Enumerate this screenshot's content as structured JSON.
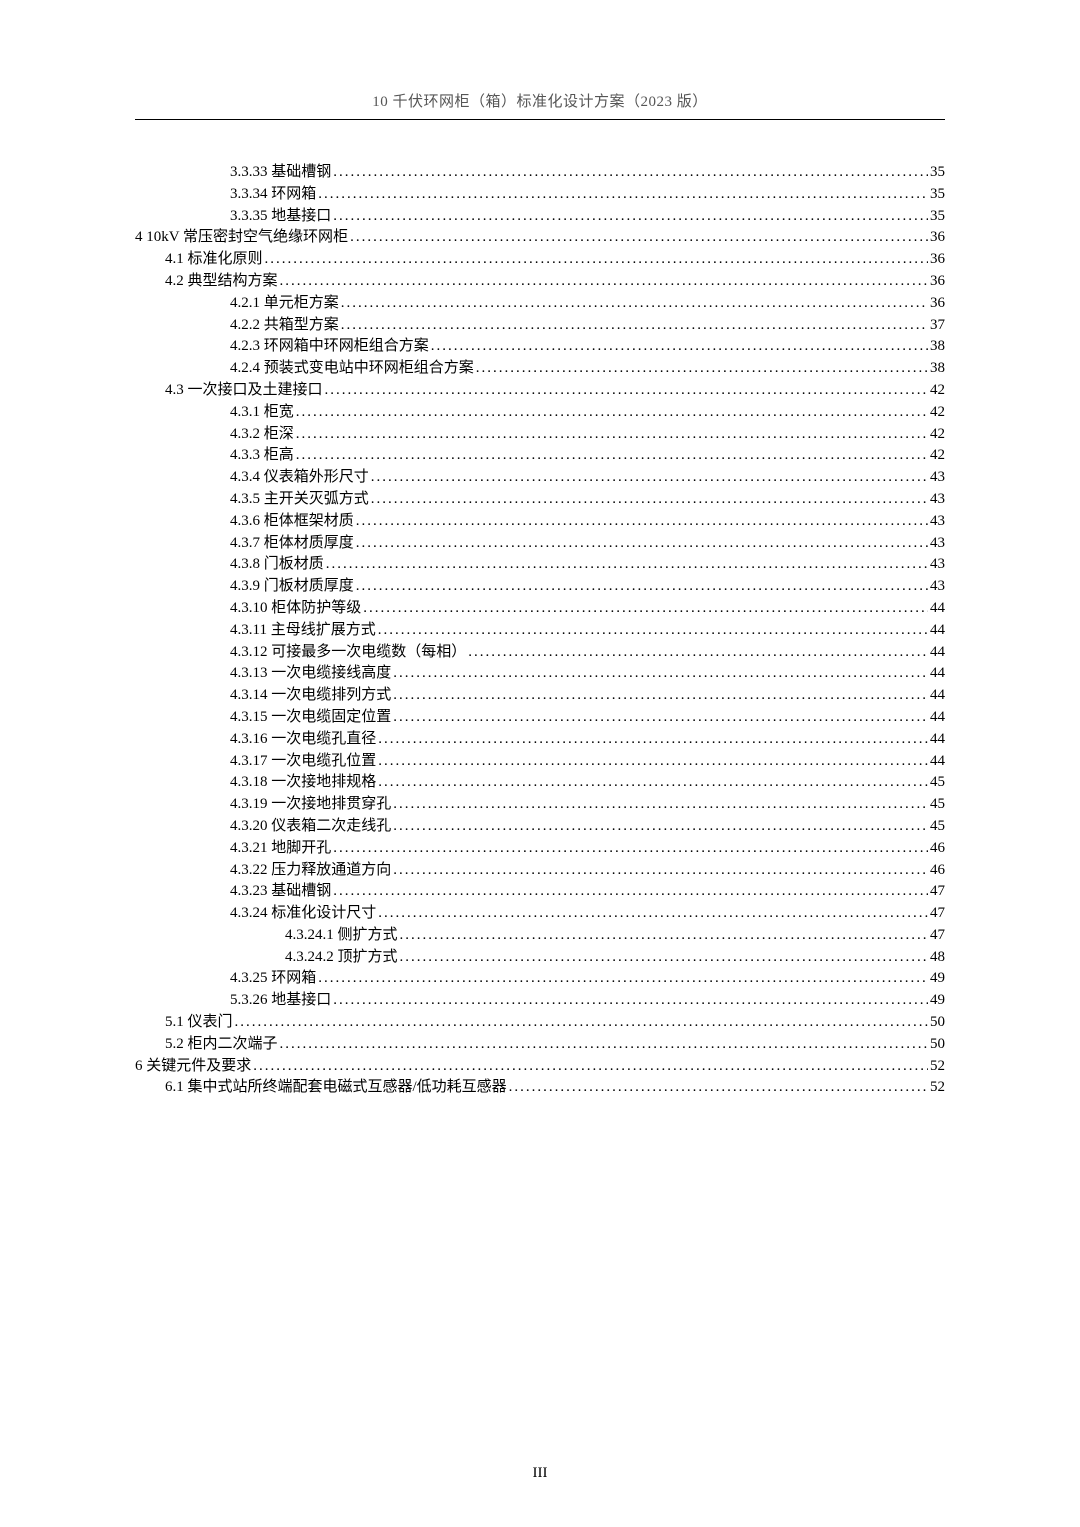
{
  "header": "10 千伏环网柜（箱）标准化设计方案（2023 版）",
  "footer": "III",
  "toc": [
    {
      "indent": 3,
      "label": "3.3.33 基础槽钢",
      "page": "35"
    },
    {
      "indent": 3,
      "label": "3.3.34 环网箱",
      "page": "35"
    },
    {
      "indent": 3,
      "label": "3.3.35 地基接口",
      "page": "35"
    },
    {
      "indent": 0,
      "label": "4 10kV 常压密封空气绝缘环网柜",
      "page": "36"
    },
    {
      "indent": 1,
      "label": "4.1 标准化原则",
      "page": "36"
    },
    {
      "indent": 1,
      "label": "4.2 典型结构方案",
      "page": "36"
    },
    {
      "indent": 3,
      "label": "4.2.1 单元柜方案",
      "page": "36"
    },
    {
      "indent": 3,
      "label": "4.2.2 共箱型方案",
      "page": "37"
    },
    {
      "indent": 3,
      "label": "4.2.3 环网箱中环网柜组合方案",
      "page": "38"
    },
    {
      "indent": 3,
      "label": "4.2.4 预装式变电站中环网柜组合方案",
      "page": "38"
    },
    {
      "indent": 1,
      "label": "4.3 一次接口及土建接口",
      "page": "42"
    },
    {
      "indent": 3,
      "label": "4.3.1 柜宽",
      "page": "42"
    },
    {
      "indent": 3,
      "label": "4.3.2 柜深",
      "page": "42"
    },
    {
      "indent": 3,
      "label": "4.3.3 柜高",
      "page": "42"
    },
    {
      "indent": 3,
      "label": "4.3.4 仪表箱外形尺寸",
      "page": "43"
    },
    {
      "indent": 3,
      "label": "4.3.5 主开关灭弧方式",
      "page": "43"
    },
    {
      "indent": 3,
      "label": "4.3.6 柜体框架材质",
      "page": "43"
    },
    {
      "indent": 3,
      "label": "4.3.7 柜体材质厚度",
      "page": "43"
    },
    {
      "indent": 3,
      "label": "4.3.8 门板材质",
      "page": "43"
    },
    {
      "indent": 3,
      "label": "4.3.9 门板材质厚度",
      "page": "43"
    },
    {
      "indent": 3,
      "label": "4.3.10 柜体防护等级",
      "page": "44"
    },
    {
      "indent": 3,
      "label": "4.3.11 主母线扩展方式",
      "page": "44"
    },
    {
      "indent": 3,
      "label": "4.3.12 可接最多一次电缆数（每相）",
      "page": "44"
    },
    {
      "indent": 3,
      "label": "4.3.13 一次电缆接线高度",
      "page": "44"
    },
    {
      "indent": 3,
      "label": "4.3.14 一次电缆排列方式",
      "page": "44"
    },
    {
      "indent": 3,
      "label": "4.3.15 一次电缆固定位置",
      "page": "44"
    },
    {
      "indent": 3,
      "label": "4.3.16 一次电缆孔直径",
      "page": "44"
    },
    {
      "indent": 3,
      "label": "4.3.17 一次电缆孔位置",
      "page": "44"
    },
    {
      "indent": 3,
      "label": "4.3.18 一次接地排规格",
      "page": "45"
    },
    {
      "indent": 3,
      "label": "4.3.19 一次接地排贯穿孔",
      "page": "45"
    },
    {
      "indent": 3,
      "label": "4.3.20 仪表箱二次走线孔",
      "page": "45"
    },
    {
      "indent": 3,
      "label": "4.3.21 地脚开孔",
      "page": "46"
    },
    {
      "indent": 3,
      "label": "4.3.22 压力释放通道方向",
      "page": "46"
    },
    {
      "indent": 3,
      "label": "4.3.23 基础槽钢",
      "page": "47"
    },
    {
      "indent": 3,
      "label": "4.3.24 标准化设计尺寸",
      "page": "47"
    },
    {
      "indent": 4,
      "label": "4.3.24.1 侧扩方式",
      "page": "47"
    },
    {
      "indent": 4,
      "label": "4.3.24.2 顶扩方式",
      "page": "48"
    },
    {
      "indent": 3,
      "label": "4.3.25 环网箱",
      "page": "49"
    },
    {
      "indent": 3,
      "label": "5.3.26 地基接口",
      "page": "49"
    },
    {
      "indent": 1,
      "label": "5.1 仪表门",
      "page": "50"
    },
    {
      "indent": 1,
      "label": "5.2 柜内二次端子",
      "page": "50"
    },
    {
      "indent": 0,
      "label": "6 关键元件及要求",
      "page": "52"
    },
    {
      "indent": 1,
      "label": "6.1 集中式站所终端配套电磁式互感器/低功耗互感器",
      "page": "52"
    }
  ]
}
